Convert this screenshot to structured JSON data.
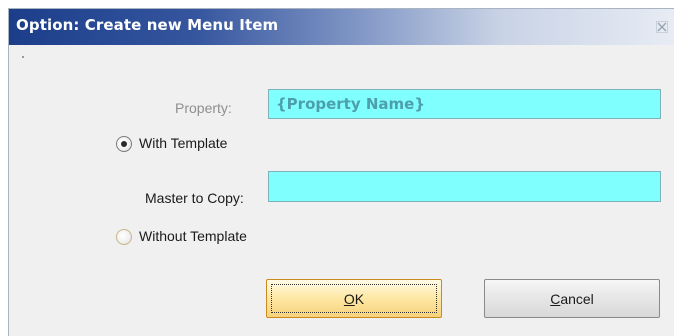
{
  "window": {
    "title": "Option: Create new Menu Item",
    "close_icon": "close-icon"
  },
  "form": {
    "property_label": "Property:",
    "property_value": "{Property Name}",
    "with_template_label": "With Template",
    "with_template_selected": true,
    "master_label": "Master to Copy:",
    "master_value": "",
    "without_template_label": "Without Template",
    "without_template_selected": false
  },
  "buttons": {
    "ok_mnemonic": "O",
    "ok_rest": "K",
    "cancel_mnemonic": "C",
    "cancel_rest": "ancel"
  },
  "colors": {
    "title_bar_start": "#1c3e8a",
    "field_bg": "#80ffff",
    "ok_button": "#fde9a8"
  }
}
